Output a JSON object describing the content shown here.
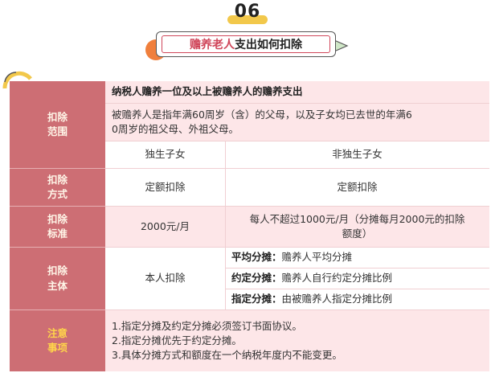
{
  "header": {
    "number": "06",
    "title_highlight": "赡养老人",
    "title_rest": "支出如何扣除"
  },
  "colors": {
    "accent": "#d0465a",
    "header_cell": "#cd6e74",
    "pink_cell": "#fde6e8",
    "note_label": "#ffd54a"
  },
  "table": {
    "scope": {
      "label_1": "扣除",
      "label_2": "范围",
      "heading": "纳税人赡养一位及以上被赡养人的赡养支出",
      "desc_line_1": "被赡养人是指年满60周岁（含）的父母，以及子女均已去世的年满6",
      "desc_line_2": "0周岁的祖父母、外祖父母。"
    },
    "columns": {
      "only_child": "独生子女",
      "non_only_child": "非独生子女"
    },
    "method": {
      "label_1": "扣除",
      "label_2": "方式",
      "only_child": "定额扣除",
      "non_only_child": "定额扣除"
    },
    "standard": {
      "label_1": "扣除",
      "label_2": "标准",
      "only_child": "2000元/月",
      "non_only_child_line_1": "每人不超过1000元/月（分摊每月2000元的扣除",
      "non_only_child_line_2": "额度）"
    },
    "subject": {
      "label_1": "扣除",
      "label_2": "主体",
      "only_child": "本人扣除",
      "options": [
        {
          "name": "平均分摊：",
          "desc": "赡养人平均分摊"
        },
        {
          "name": "约定分摊：",
          "desc": "赡养人自行约定分摊比例"
        },
        {
          "name": "指定分摊：",
          "desc": "由被赡养人指定分摊比例"
        }
      ]
    },
    "notes": {
      "label_1": "注意",
      "label_2": "事项",
      "items": [
        "1.指定分摊及约定分摊必须签订书面协议。",
        "2.指定分摊优先于约定分摊。",
        "3.具体分摊方式和额度在一个纳税年度内不能变更。"
      ]
    }
  }
}
